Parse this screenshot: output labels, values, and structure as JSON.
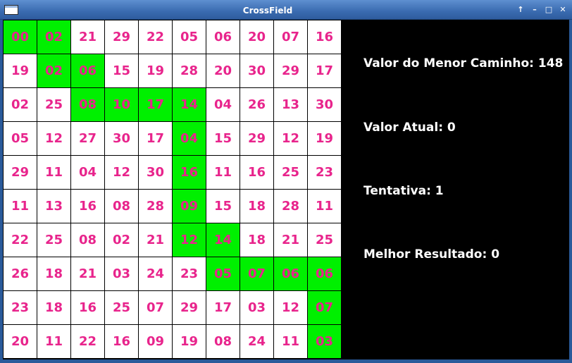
{
  "window": {
    "title": "CrossField",
    "buttons": [
      "↑",
      "–",
      "□",
      "✕"
    ]
  },
  "grid": {
    "rows": [
      [
        "00",
        "02",
        "21",
        "29",
        "22",
        "05",
        "06",
        "20",
        "07",
        "16"
      ],
      [
        "19",
        "02",
        "06",
        "15",
        "19",
        "28",
        "20",
        "30",
        "29",
        "17"
      ],
      [
        "02",
        "25",
        "08",
        "10",
        "17",
        "14",
        "04",
        "26",
        "13",
        "30"
      ],
      [
        "05",
        "12",
        "27",
        "30",
        "17",
        "04",
        "15",
        "29",
        "12",
        "19"
      ],
      [
        "29",
        "11",
        "04",
        "12",
        "30",
        "16",
        "11",
        "16",
        "25",
        "23"
      ],
      [
        "11",
        "13",
        "16",
        "08",
        "28",
        "09",
        "15",
        "18",
        "28",
        "11"
      ],
      [
        "22",
        "25",
        "08",
        "02",
        "21",
        "12",
        "14",
        "18",
        "21",
        "25"
      ],
      [
        "26",
        "18",
        "21",
        "03",
        "24",
        "23",
        "05",
        "07",
        "06",
        "06"
      ],
      [
        "23",
        "18",
        "16",
        "25",
        "07",
        "29",
        "17",
        "03",
        "12",
        "07"
      ],
      [
        "20",
        "11",
        "22",
        "16",
        "09",
        "19",
        "08",
        "24",
        "11",
        "03"
      ]
    ],
    "highlighted": [
      [
        0,
        0
      ],
      [
        0,
        1
      ],
      [
        1,
        1
      ],
      [
        1,
        2
      ],
      [
        2,
        2
      ],
      [
        2,
        3
      ],
      [
        2,
        4
      ],
      [
        2,
        5
      ],
      [
        3,
        5
      ],
      [
        4,
        5
      ],
      [
        5,
        5
      ],
      [
        6,
        5
      ],
      [
        6,
        6
      ],
      [
        7,
        6
      ],
      [
        7,
        7
      ],
      [
        7,
        8
      ],
      [
        7,
        9
      ],
      [
        8,
        9
      ],
      [
        9,
        9
      ]
    ],
    "cell_color": "#ffffff",
    "path_color": "#00f000",
    "text_color": "#e8248c"
  },
  "info": {
    "shortest_path": "Valor do Menor Caminho: 148",
    "current_value": "Valor Atual: 0",
    "attempt": "Tentativa: 1",
    "best_result": "Melhor Resultado: 0"
  }
}
